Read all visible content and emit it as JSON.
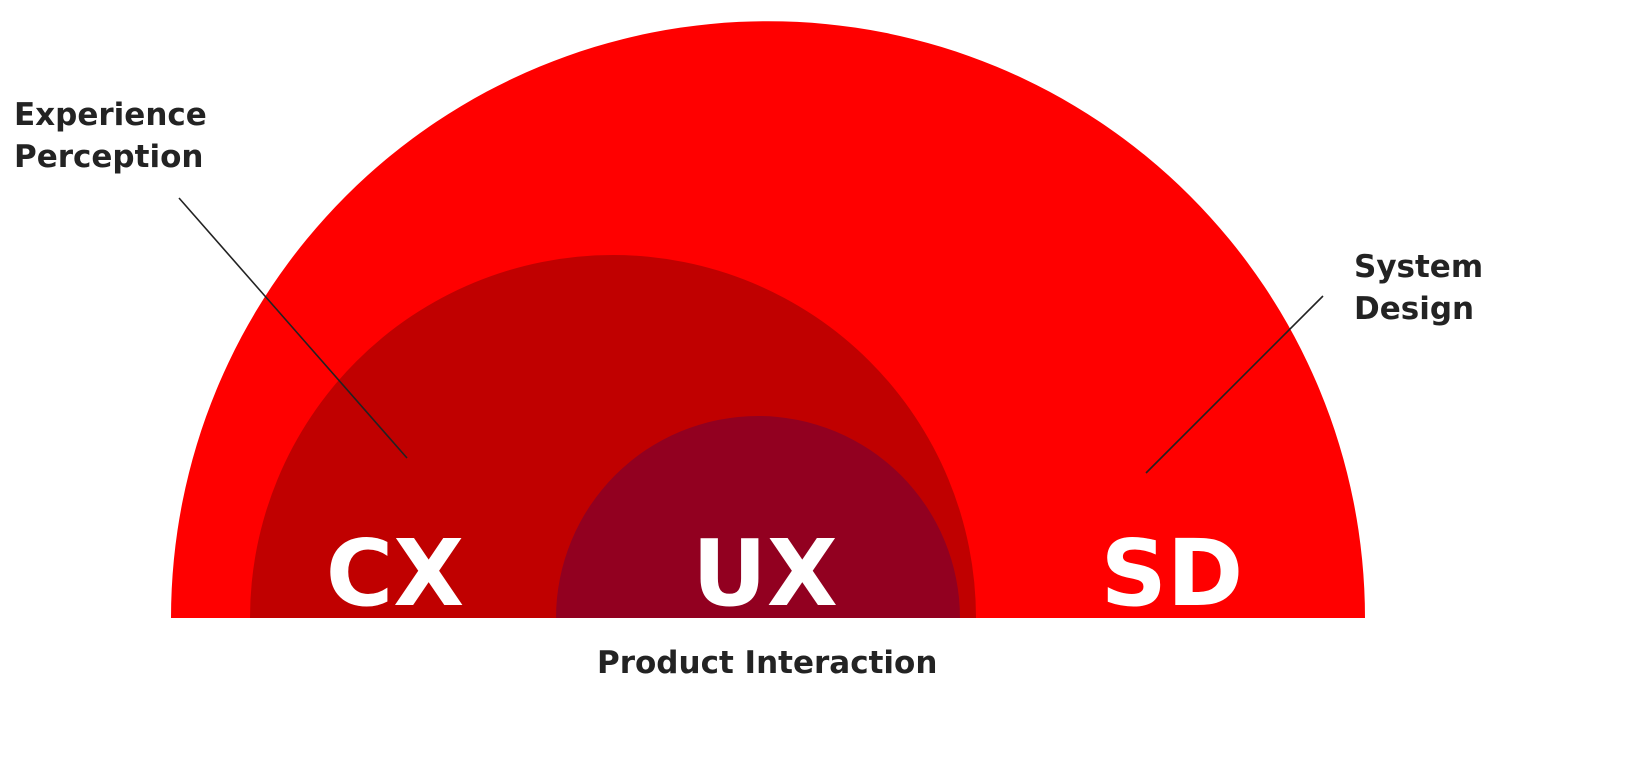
{
  "labels": {
    "experience_line1": "Experience",
    "experience_line2": "Perception",
    "system_line1": "System",
    "system_line2": "Design",
    "product": "Product Interaction"
  },
  "segments": {
    "cx": "CX",
    "ux": "UX",
    "sd": "SD"
  },
  "colors": {
    "outer_arc": "#ff0000",
    "middle_arc": "#c00000",
    "inner_arc": "#920020",
    "segment_text": "#ffffff",
    "label_text": "#232323",
    "leader_line": "#222222",
    "background": "#ffffff"
  }
}
